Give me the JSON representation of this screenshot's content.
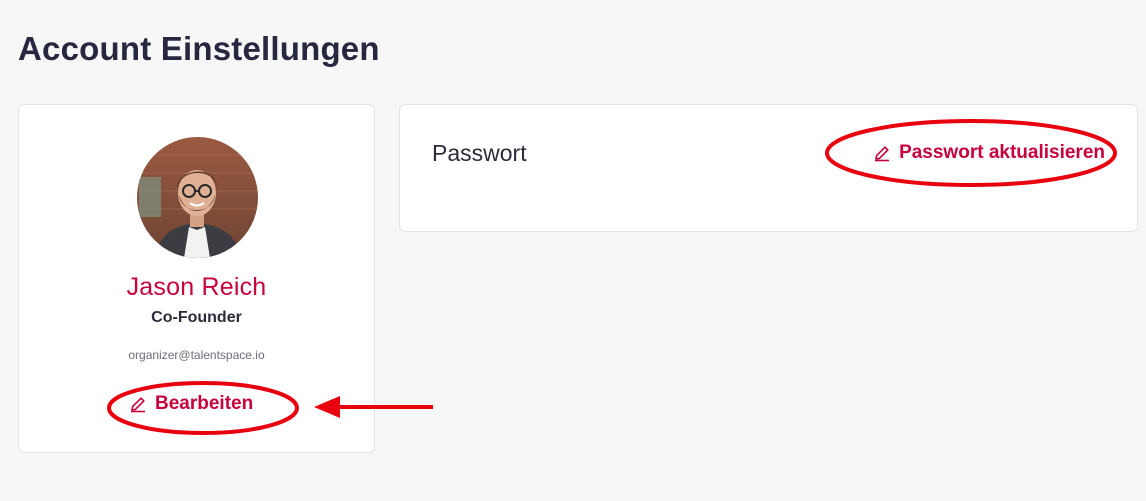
{
  "page": {
    "title": "Account Einstellungen"
  },
  "profile": {
    "name": "Jason Reich",
    "role": "Co-Founder",
    "email": "organizer@talentspace.io",
    "edit_label": "Bearbeiten",
    "edit_icon": "pencil-icon",
    "avatar": "profile-photo"
  },
  "password": {
    "title": "Passwort",
    "update_label": "Passwort aktualisieren",
    "update_icon": "pencil-icon"
  },
  "colors": {
    "accent": "#c8003c",
    "title": "#27283f",
    "background": "#f7f7f8",
    "annotation": "#e8000f"
  }
}
